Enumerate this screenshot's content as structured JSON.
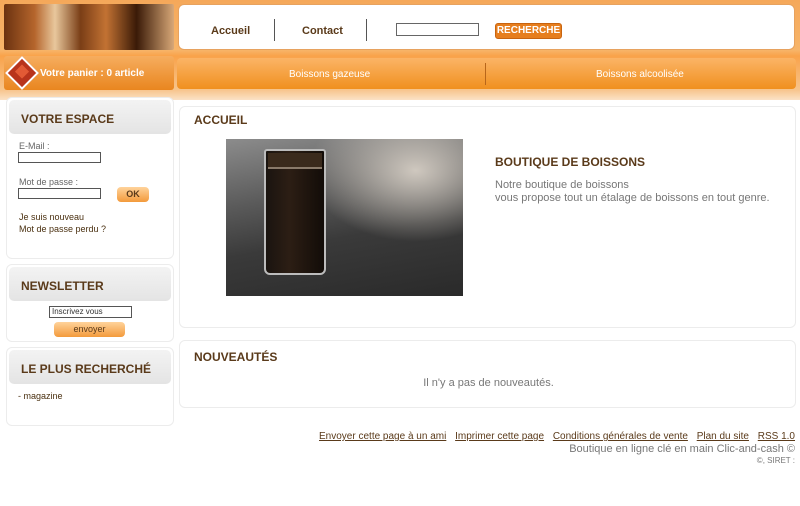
{
  "header": {
    "nav": [
      "Accueil",
      "Contact"
    ],
    "search_button": "RECHERCHE",
    "cart": "Votre panier : 0 article"
  },
  "categories": [
    "Boissons gazeuse",
    "Boissons alcoolisée"
  ],
  "sidebar": {
    "espace": {
      "title": "VOTRE ESPACE",
      "email_label": "E-Mail :",
      "password_label": "Mot de passe :",
      "ok_label": "OK",
      "new_user": "Je suis nouveau",
      "lost_password": "Mot de passe perdu ?"
    },
    "newsletter": {
      "title": "NEWSLETTER",
      "placeholder": "Inscrivez vous",
      "button": "envoyer"
    },
    "most_searched": {
      "title": "LE PLUS RECHERCHÉ",
      "items": [
        "- magazine"
      ]
    }
  },
  "main": {
    "home_title": "ACCUEIL",
    "shop_title": "BOUTIQUE DE BOISSONS",
    "shop_text_1": "Notre boutique de boissons",
    "shop_text_2": "vous propose tout un étalage de boissons en tout genre.",
    "new_title": "NOUVEAUTÉS",
    "new_empty": "Il n'y a pas de nouveautés."
  },
  "footer": {
    "links": [
      "Envoyer cette page à un ami",
      "Imprimer cette page",
      "Conditions générales de vente",
      "Plan du site",
      "RSS 1.0"
    ],
    "line2": "Boutique en ligne clé en main Clic-and-cash ©",
    "line3": "©, SIRET :"
  }
}
